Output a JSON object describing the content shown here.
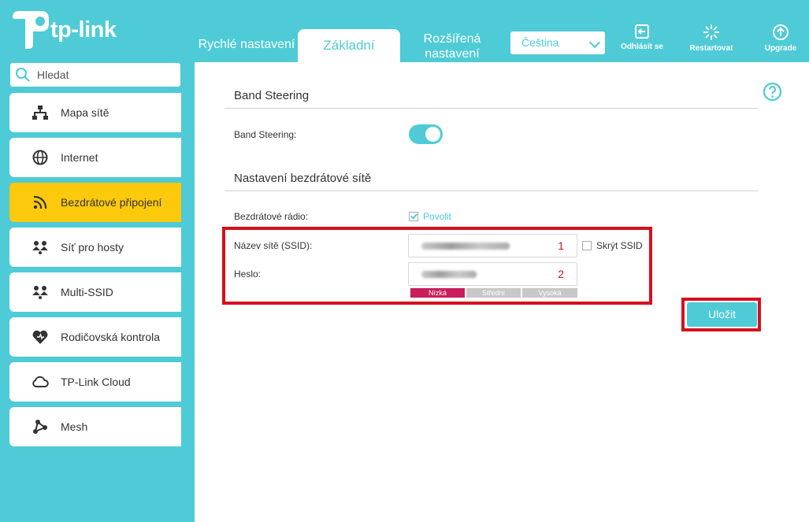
{
  "header": {
    "brand": "tp-link",
    "tabs": {
      "quick": "Rychlé nastavení",
      "basic": "Základní",
      "advanced_line1": "Rozšířená",
      "advanced_line2": "nastavení"
    },
    "language": "Čeština",
    "buttons": {
      "logout": "Odhlásit se",
      "restart": "Restartovat",
      "upgrade": "Upgrade"
    }
  },
  "sidebar": {
    "search_placeholder": "Hledat",
    "items": [
      {
        "label": "Mapa sítě",
        "icon": "network-map-icon"
      },
      {
        "label": "Internet",
        "icon": "globe-icon"
      },
      {
        "label": "Bezdrátové připojení",
        "icon": "wireless-icon",
        "active": true
      },
      {
        "label": "Síť pro hosty",
        "icon": "guest-network-icon"
      },
      {
        "label": "Multi-SSID",
        "icon": "multi-ssid-icon"
      },
      {
        "label": "Rodičovská kontrola",
        "icon": "parental-heart-icon"
      },
      {
        "label": "TP-Link Cloud",
        "icon": "cloud-icon"
      },
      {
        "label": "Mesh",
        "icon": "mesh-icon"
      }
    ]
  },
  "main": {
    "band_steering": {
      "section_title": "Band Steering",
      "label": "Band Steering:",
      "enabled": true
    },
    "wireless": {
      "section_title": "Nastavení bezdrátové sítě",
      "radio_label": "Bezdrátové rádio:",
      "radio_enable_label": "Povolit",
      "radio_enabled": true,
      "ssid_label": "Název sítě (SSID):",
      "ssid_marker": "1",
      "hide_ssid_label": "Skrýt SSID",
      "password_label": "Heslo:",
      "password_marker": "2",
      "strength": {
        "low": "Nízká",
        "medium": "Střední",
        "high": "Vysoká",
        "current": "low"
      }
    },
    "save_label": "Uložit"
  },
  "colors": {
    "accent": "#4ecbd6",
    "active_nav": "#fcc90c",
    "highlight_box": "#d6101c",
    "strength_low": "#c81e5a",
    "strength_inactive": "#c8c8c8"
  }
}
